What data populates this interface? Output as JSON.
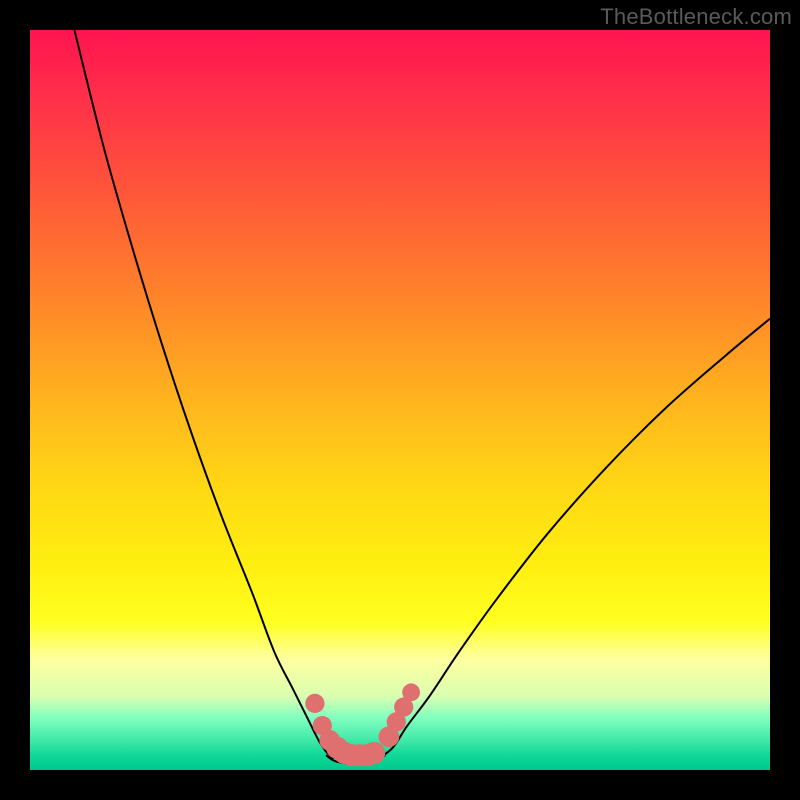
{
  "watermark": "TheBottleneck.com",
  "chart_data": {
    "type": "line",
    "title": "",
    "xlabel": "",
    "ylabel": "",
    "xlim": [
      0,
      100
    ],
    "ylim": [
      0,
      100
    ],
    "series": [
      {
        "name": "left-curve",
        "x": [
          6,
          10,
          14,
          18,
          22,
          26,
          30,
          33,
          35.5,
          37.5,
          39,
          40,
          41
        ],
        "y": [
          100,
          84,
          70,
          57,
          45,
          34,
          24,
          16,
          11,
          7,
          4,
          2.5,
          1.5
        ]
      },
      {
        "name": "right-curve",
        "x": [
          47,
          49,
          51,
          54,
          58,
          63,
          70,
          78,
          86,
          94,
          100
        ],
        "y": [
          1.5,
          3,
          6,
          10,
          16,
          23,
          32,
          41,
          49,
          56,
          61
        ]
      },
      {
        "name": "floor",
        "x": [
          40,
          41,
          42,
          43,
          44,
          45,
          46,
          47,
          48
        ],
        "y": [
          2,
          1.3,
          1,
          0.9,
          0.9,
          0.9,
          1,
          1.3,
          2
        ]
      }
    ],
    "markers": [
      {
        "x": 38.5,
        "y": 9,
        "r": 1.3
      },
      {
        "x": 39.5,
        "y": 6,
        "r": 1.3
      },
      {
        "x": 40.5,
        "y": 4,
        "r": 1.4
      },
      {
        "x": 41.5,
        "y": 3,
        "r": 1.5
      },
      {
        "x": 42.5,
        "y": 2.3,
        "r": 1.5
      },
      {
        "x": 43.5,
        "y": 2,
        "r": 1.5
      },
      {
        "x": 44.5,
        "y": 2,
        "r": 1.5
      },
      {
        "x": 45.5,
        "y": 2,
        "r": 1.5
      },
      {
        "x": 46.5,
        "y": 2.3,
        "r": 1.5
      },
      {
        "x": 48.5,
        "y": 4.5,
        "r": 1.4
      },
      {
        "x": 49.5,
        "y": 6.5,
        "r": 1.3
      },
      {
        "x": 50.5,
        "y": 8.5,
        "r": 1.3
      },
      {
        "x": 51.5,
        "y": 10.5,
        "r": 1.2
      }
    ],
    "gradient_stops": [
      {
        "pos": 0,
        "color": "#ff1450"
      },
      {
        "pos": 0.5,
        "color": "#ffb41e"
      },
      {
        "pos": 0.8,
        "color": "#ffff20"
      },
      {
        "pos": 1.0,
        "color": "#00c88c"
      }
    ]
  }
}
